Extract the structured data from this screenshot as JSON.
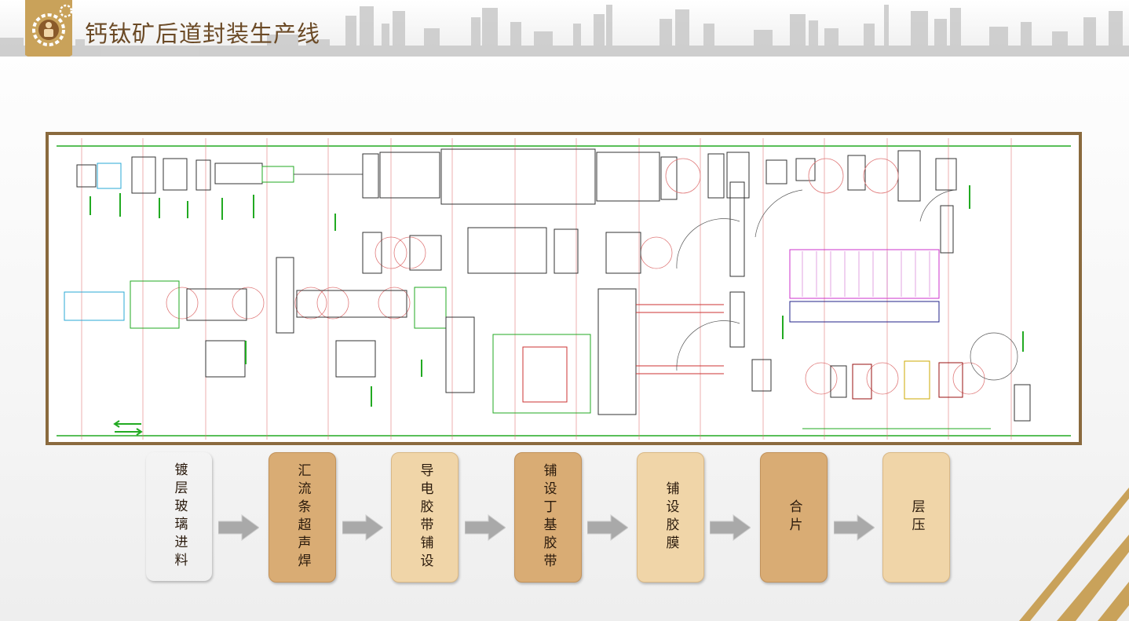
{
  "header": {
    "title": "钙钛矿后道封装生产线",
    "badge_icon": "worker-gear-icon"
  },
  "drawing": {
    "description_icon": "production-line-layout-drawing"
  },
  "flow": {
    "steps": [
      {
        "label": "镀层玻璃进料",
        "tone": "light"
      },
      {
        "label": "汇流条超声焊",
        "tone": "dark"
      },
      {
        "label": "导电胶带铺设",
        "tone": "light"
      },
      {
        "label": "铺设丁基胶带",
        "tone": "dark"
      },
      {
        "label": "铺设胶膜",
        "tone": "light"
      },
      {
        "label": "合片",
        "tone": "dark"
      },
      {
        "label": "层压",
        "tone": "light"
      }
    ]
  },
  "colors": {
    "accent_brown": "#8a6a3e",
    "step_light": "#f0d5a8",
    "step_dark": "#d9ac74",
    "arrow_gray": "#a9a9a9",
    "corner_gold": "#c9a25a"
  }
}
